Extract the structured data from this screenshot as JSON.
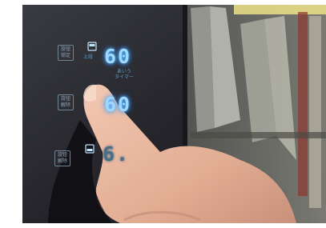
{
  "panel": {
    "rows": [
      {
        "button_line1": "旋钮",
        "button_line2": "锁定",
        "mode_label": "上段",
        "digits": "60",
        "sub_label": "あいう\nタイマー"
      },
      {
        "button_line1": "旋钮",
        "button_line2": "解除",
        "mode_label": "",
        "digits": "60",
        "sub_label": ""
      },
      {
        "button_line1": "旋钮",
        "button_line2": "解除",
        "mode_label": "",
        "digits": "6.",
        "sub_label": ""
      }
    ]
  },
  "colors": {
    "display_glow": "#9fd8ff",
    "panel_glass": "#2a2a30",
    "skin": "#e7b9a1",
    "reflection_yellow": "#f4e98a"
  }
}
